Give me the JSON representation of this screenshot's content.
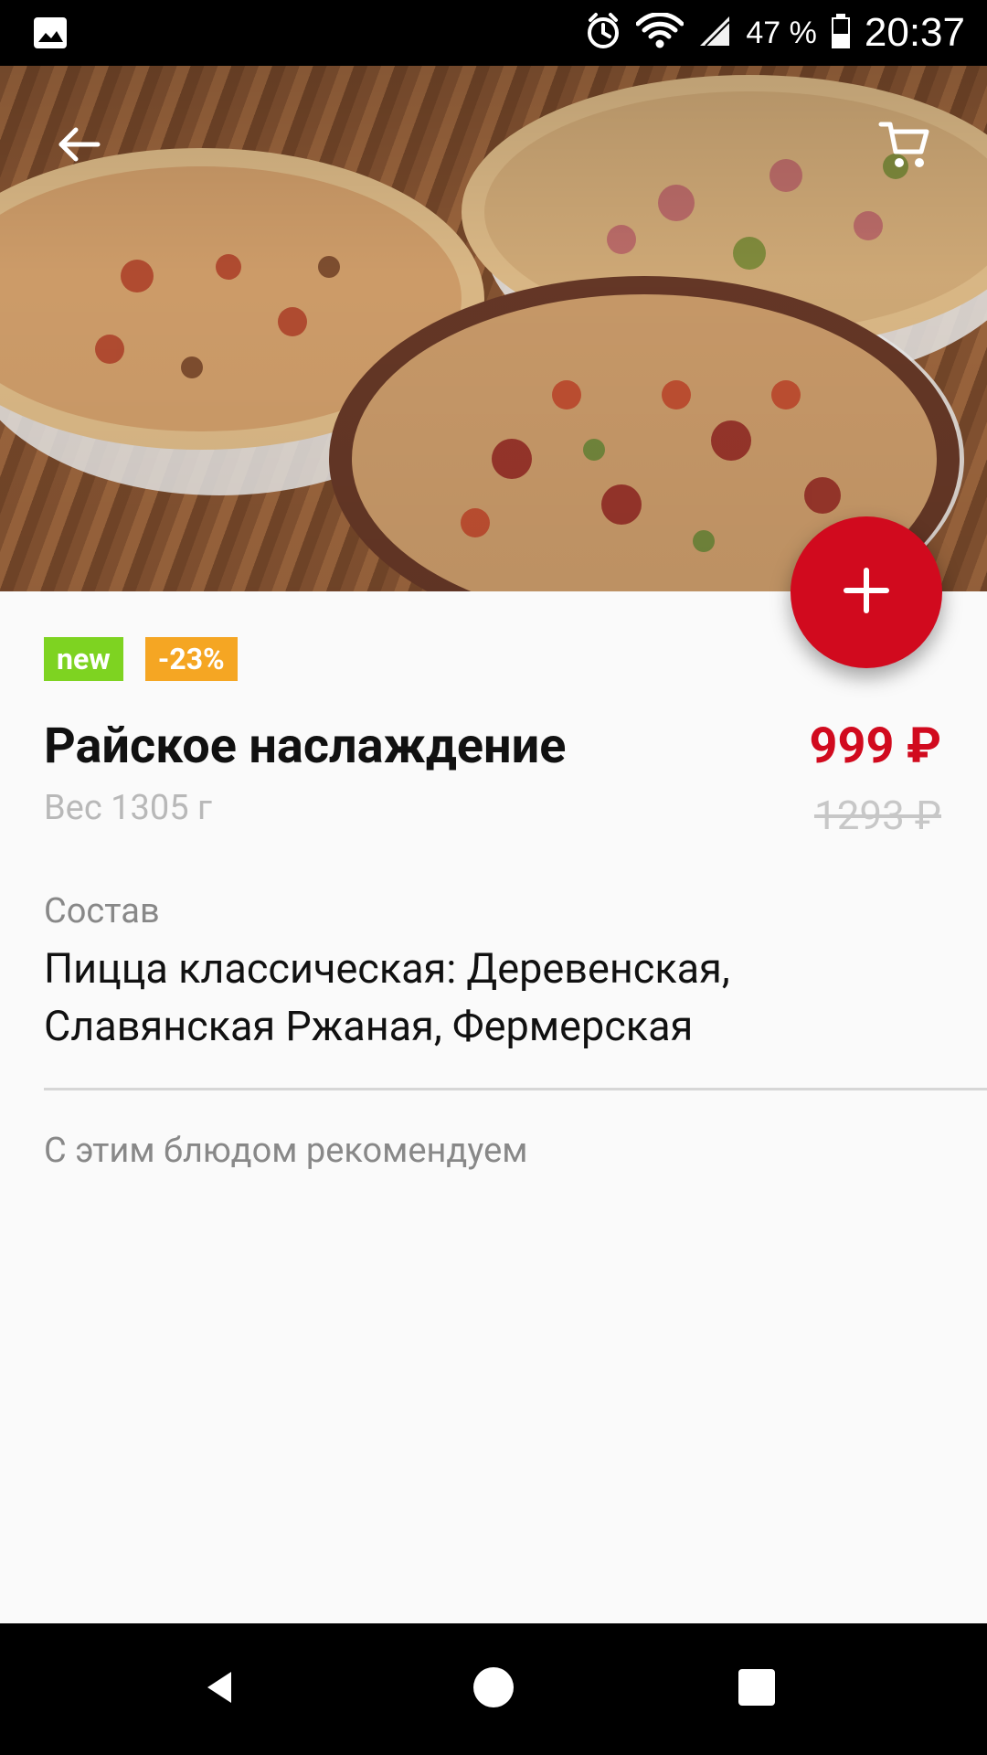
{
  "status_bar": {
    "battery_text": "47 %",
    "time": "20:37",
    "icons": [
      "image-icon",
      "alarm-icon",
      "wifi-icon",
      "signal-icon",
      "battery-icon"
    ]
  },
  "product": {
    "image_alt": "Pizza set",
    "badges": {
      "new": "new",
      "discount": "-23%"
    },
    "title": "Райское наслаждение",
    "weight": "Вес 1305 г",
    "price": "999 ₽",
    "old_price": "1293 ₽",
    "composition_label": "Состав",
    "composition_text": "Пицца классическая: Деревенская, Славянская Ржаная, Фермерская",
    "recommend_label": "С этим блюдом рекомендуем"
  },
  "colors": {
    "accent_red": "#d10a1e",
    "badge_new_green": "#7ed321",
    "badge_discount_orange": "#f5a623"
  },
  "nav_bar": {
    "icons": [
      "back-icon",
      "home-icon",
      "recent-apps-icon"
    ]
  }
}
